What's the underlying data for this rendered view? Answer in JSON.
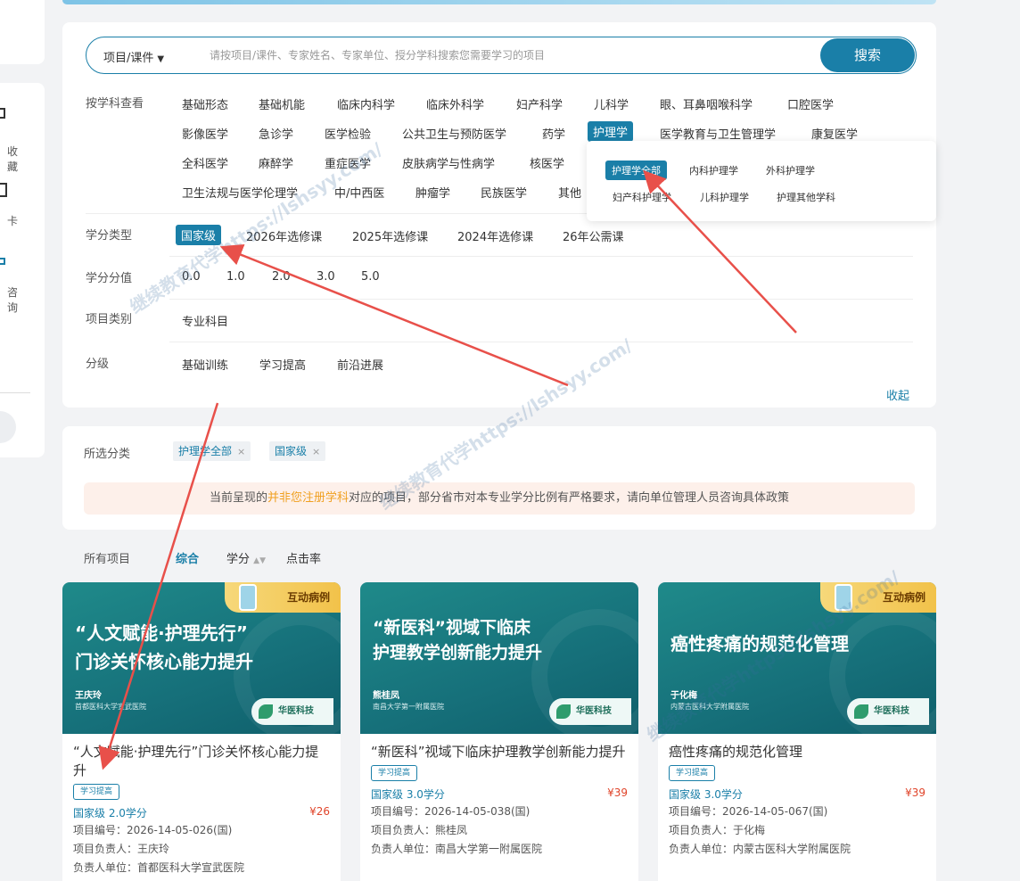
{
  "sidebar": {
    "items": [
      {
        "label": "收藏"
      },
      {
        "label": "卡"
      },
      {
        "label": "咨询"
      }
    ]
  },
  "search": {
    "type_label": "项目/课件",
    "placeholder": "请按项目/课件、专家姓名、专家单位、授分学科搜索您需要学习的项目",
    "button_label": "搜索"
  },
  "filters": {
    "subject": {
      "label": "按学科查看",
      "row1": [
        "基础形态",
        "基础机能",
        "临床内科学",
        "临床外科学",
        "妇产科学",
        "儿科学",
        "眼、耳鼻咽喉科学",
        "口腔医学"
      ],
      "row2": [
        "影像医学",
        "急诊学",
        "医学检验",
        "公共卫生与预防医学",
        "药学",
        "护理学",
        "医学教育与卫生管理学",
        "康复医学"
      ],
      "row3": [
        "全科医学",
        "麻醉学",
        "重症医学",
        "皮肤病学与性病学",
        "核医学"
      ],
      "row4": [
        "卫生法规与医学伦理学",
        "中/中西医",
        "肿瘤学",
        "民族医学",
        "其他"
      ],
      "active": "护理学"
    },
    "credit_type": {
      "label": "学分类型",
      "items": [
        "国家级",
        "2026年选修课",
        "2025年选修课",
        "2024年选修课",
        "26年公需课"
      ],
      "active": "国家级"
    },
    "credit_value": {
      "label": "学分分值",
      "items": [
        "0.0",
        "1.0",
        "2.0",
        "3.0",
        "5.0"
      ]
    },
    "project_category": {
      "label": "项目类别",
      "items": [
        "专业科目"
      ]
    },
    "level": {
      "label": "分级",
      "items": [
        "基础训练",
        "学习提高",
        "前沿进展"
      ]
    },
    "collapse_label": "收起"
  },
  "subject_popup": {
    "items": [
      "护理学全部",
      "内科护理学",
      "外科护理学",
      "妇产科护理学",
      "儿科护理学",
      "护理其他学科"
    ],
    "active": "护理学全部"
  },
  "selected": {
    "label": "所选分类",
    "tags": [
      "护理学全部",
      "国家级"
    ],
    "remove_glyph": "×",
    "notice_prefix": "当前呈现的",
    "notice_highlight": "并非您注册学科",
    "notice_suffix": "对应的项目，部分省市对本专业学分比例有严格要求，请向单位管理人员咨询具体政策"
  },
  "sort": {
    "label": "所有项目",
    "items": [
      "综合",
      "学分",
      "点击率"
    ],
    "active": "综合",
    "updown_glyph": "▲▼"
  },
  "courses": [
    {
      "badge": "互动病例",
      "cover_line1": "“人文赋能·护理先行”",
      "cover_line2": "门诊关怀核心能力提升",
      "cover_expert": "王庆玲",
      "cover_unit": "首都医科大学宣武医院",
      "logo": "华医科技",
      "title": "“人文赋能·护理先行”门诊关怀核心能力提升",
      "level_tag": "学习提高",
      "credit": "国家级 2.0学分",
      "price": "¥26",
      "code": "项目编号：2026-14-05-026(国)",
      "leader": "项目负责人：王庆玲",
      "unit": "负责人单位：首都医科大学宣武医院"
    },
    {
      "badge": "",
      "cover_line1": "“新医科”视域下临床",
      "cover_line2": "护理教学创新能力提升",
      "cover_expert": "熊桂凤",
      "cover_unit": "南昌大学第一附属医院",
      "logo": "华医科技",
      "title": "“新医科”视域下临床护理教学创新能力提升",
      "level_tag": "学习提高",
      "credit": "国家级 3.0学分",
      "price": "¥39",
      "code": "项目编号：2026-14-05-038(国)",
      "leader": "项目负责人：熊桂凤",
      "unit": "负责人单位：南昌大学第一附属医院"
    },
    {
      "badge": "互动病例",
      "cover_line1": "癌性疼痛的规范化管理",
      "cover_line2": "",
      "cover_expert": "于化梅",
      "cover_unit": "内蒙古医科大学附属医院",
      "logo": "华医科技",
      "title": "癌性疼痛的规范化管理",
      "level_tag": "学习提高",
      "credit": "国家级 3.0学分",
      "price": "¥39",
      "code": "项目编号：2026-14-05-067(国)",
      "leader": "项目负责人：于化梅",
      "unit": "负责人单位：内蒙古医科大学附属医院"
    }
  ],
  "watermark": "继续教育代学https://lshsyy.com/",
  "colors": {
    "primary": "#1a7fa8",
    "price": "#e0442a",
    "highlight": "#f0a020",
    "arrow": "#e8504a"
  }
}
